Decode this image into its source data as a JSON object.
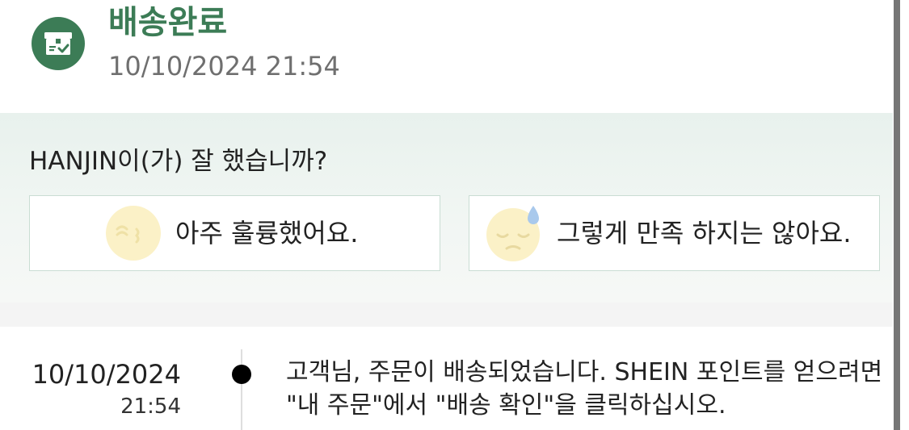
{
  "header": {
    "status_title": "배송완료",
    "status_time": "10/10/2024 21:54",
    "status_icon": "delivered-box-check-icon",
    "accent_color": "#3c7c56"
  },
  "rating": {
    "question": "HANJIN이(가) 잘 했습니까?",
    "options": [
      {
        "label": "아주 훌륭했어요.",
        "icon": "kissing-face-icon"
      },
      {
        "label": "그렇게 만족 하지는 않아요.",
        "icon": "sad-sweat-face-icon"
      }
    ]
  },
  "timeline": {
    "events": [
      {
        "date": "10/10/2024",
        "time": "21:54",
        "message": "고객님, 주문이 배송되었습니다. SHEIN 포인트를 얻으려면 \"내 주문\"에서 \"배송 확인\"을 클릭하십시오."
      }
    ]
  }
}
